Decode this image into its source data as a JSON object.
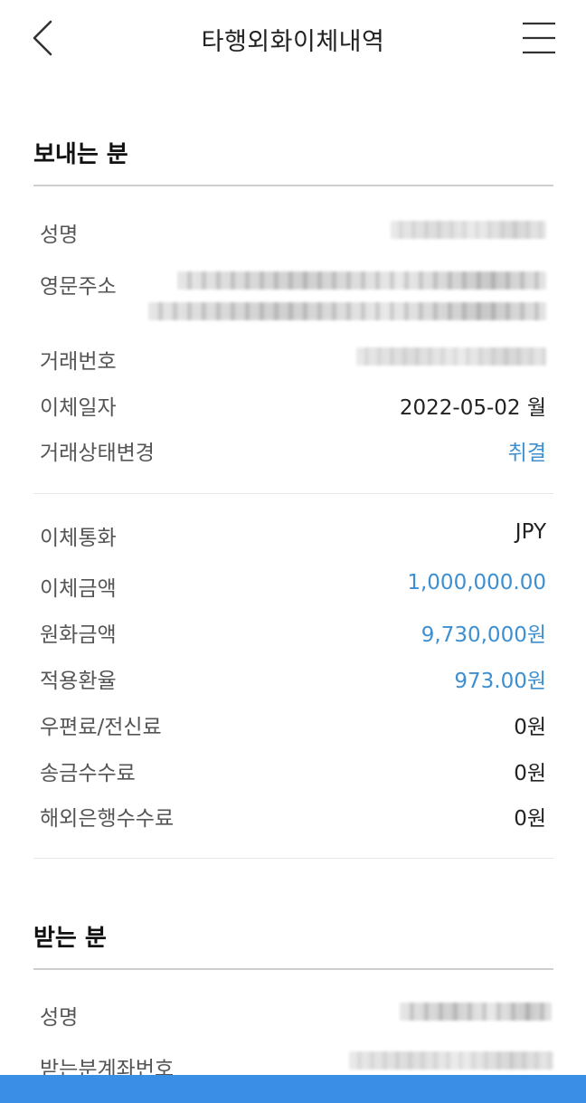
{
  "header": {
    "title": "타행외화이체내역",
    "back_icon": "chevron-left-icon",
    "menu_icon": "hamburger-menu-icon"
  },
  "sender": {
    "section_title": "보내는 분",
    "rows": [
      {
        "label": "성명",
        "value": ""
      },
      {
        "label": "영문주소",
        "value": ""
      },
      {
        "label": "거래번호",
        "value": ""
      },
      {
        "label": "이체일자",
        "value": "2022-05-02 월"
      },
      {
        "label": "거래상태변경",
        "value": "취결"
      }
    ]
  },
  "amounts": {
    "rows": [
      {
        "label": "이체통화",
        "value": "JPY"
      },
      {
        "label": "이체금액",
        "value": "1,000,000.00"
      },
      {
        "label": "원화금액",
        "value": "9,730,000원"
      },
      {
        "label": "적용환율",
        "value": "973.00원"
      },
      {
        "label": "우편료/전신료",
        "value": "0원"
      },
      {
        "label": "송금수수료",
        "value": "0원"
      },
      {
        "label": "해외은행수수료",
        "value": "0원"
      }
    ]
  },
  "receiver": {
    "section_title": "받는 분",
    "rows": [
      {
        "label": "성명",
        "value": ""
      },
      {
        "label": "받는분계좌번호",
        "value": ""
      }
    ]
  },
  "colors": {
    "accent_blue": "#3e8fd0",
    "bottom_bar": "#3a8ee6"
  }
}
